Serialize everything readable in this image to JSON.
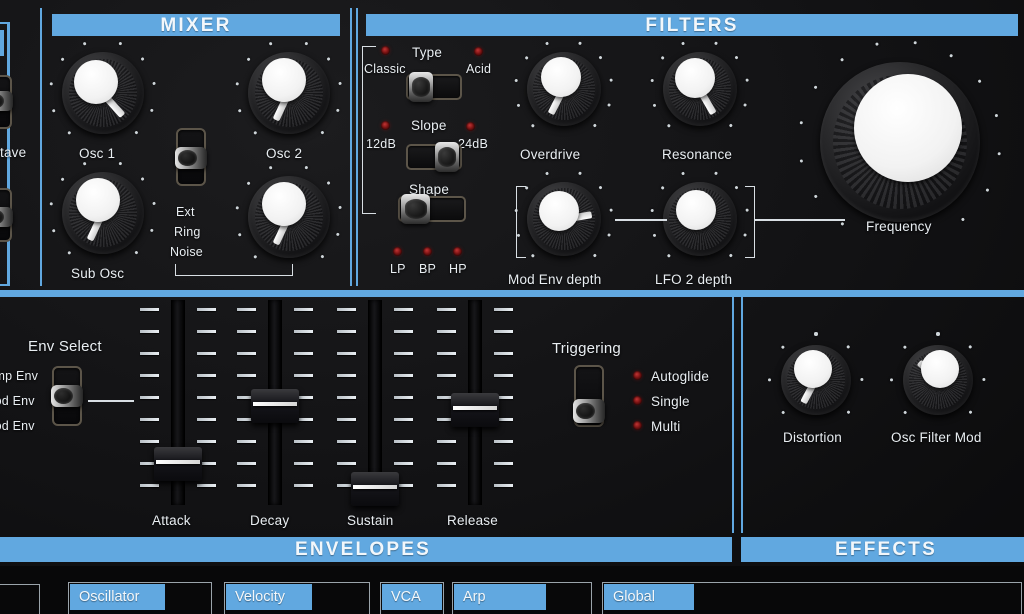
{
  "device": {
    "panel_background": "#121214",
    "accent_blue": "#61a8e0",
    "led_red": "#7d1414"
  },
  "sections": {
    "mixer": {
      "title": "MIXER",
      "knobs": [
        {
          "label": "Osc 1",
          "angle": 138,
          "value_pct": 66
        },
        {
          "label": "Osc 2",
          "angle": 205,
          "value_pct": 86
        },
        {
          "label": "Sub Osc",
          "angle": 205,
          "value_pct": 86
        },
        {
          "label": "",
          "angle": 205,
          "value_pct": 86
        }
      ],
      "source_switch": {
        "name": "Ext Ring Noise",
        "options": [
          "Ext",
          "Ring",
          "Noise"
        ],
        "selected": "Ring"
      }
    },
    "filters": {
      "title": "FILTERS",
      "type_switch": {
        "label": "Type",
        "options": [
          "Classic",
          "Acid"
        ],
        "selected": "Classic"
      },
      "slope_switch": {
        "label": "Slope",
        "options": [
          "12dB",
          "24dB"
        ],
        "selected": "24dB"
      },
      "shape_switch": {
        "label": "Shape",
        "options": [
          "LP",
          "BP",
          "HP"
        ],
        "selected": "LP"
      },
      "knobs": [
        {
          "label": "Overdrive",
          "angle": 207,
          "value_pct": 85
        },
        {
          "label": "Resonance",
          "angle": 150,
          "value_pct": 72
        },
        {
          "label": "Mod Env depth",
          "angle": 80,
          "value_pct": 44
        },
        {
          "label": "LFO 2 depth",
          "angle": 2,
          "value_pct": 1
        },
        {
          "label": "Frequency",
          "angle": 25,
          "value_pct": 14
        }
      ]
    },
    "envelopes": {
      "title": "ENVELOPES",
      "env_select": {
        "label": "Env Select",
        "options": [
          "Amp Env",
          "Mod Env",
          "Mod Env"
        ],
        "selected": "Mod Env"
      },
      "sliders": [
        {
          "label": "Attack",
          "value_pct": 22
        },
        {
          "label": "Decay",
          "value_pct": 56
        },
        {
          "label": "Sustain",
          "value_pct": 6
        },
        {
          "label": "Release",
          "value_pct": 55
        }
      ],
      "triggering": {
        "label": "Triggering",
        "options": [
          "Autoglide",
          "Single",
          "Multi"
        ],
        "selected": "Multi"
      }
    },
    "effects": {
      "title": "EFFECTS",
      "knobs": [
        {
          "label": "Distortion",
          "angle": 208,
          "value_pct": 86
        },
        {
          "label": "Osc Filter Mod",
          "angle": 312,
          "value_pct": 31
        }
      ]
    },
    "left_edge": {
      "partial_label": "tave"
    }
  },
  "bottom_tabs": [
    {
      "label": "Oscillator"
    },
    {
      "label": "Velocity"
    },
    {
      "label": "VCA"
    },
    {
      "label": "Arp"
    },
    {
      "label": "Global"
    }
  ]
}
